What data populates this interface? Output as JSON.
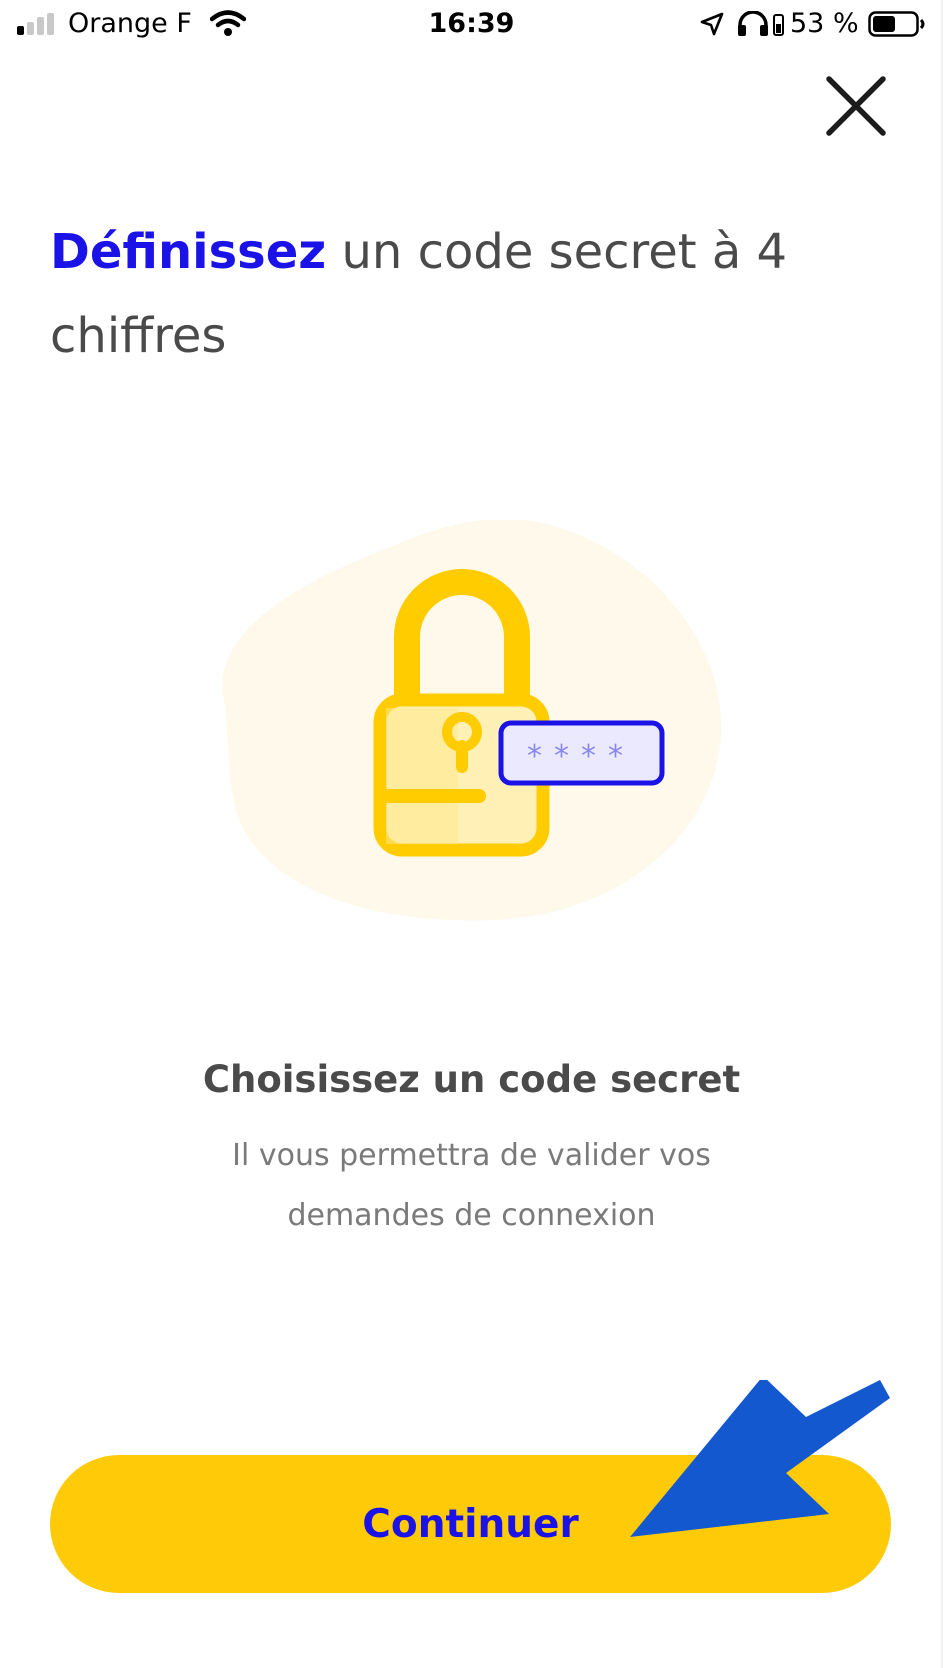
{
  "status_bar": {
    "carrier": "Orange F",
    "time": "16:39",
    "battery": "53 %",
    "signal_bars_active": 1,
    "signal_bars_total": 4,
    "icons": [
      "signal-icon",
      "wifi-icon",
      "location-arrow-icon",
      "headphones-icon",
      "battery-icon"
    ]
  },
  "header": {
    "close_icon": "close-icon"
  },
  "title": {
    "accent": "Définissez",
    "rest": " un code secret à 4 chiffres"
  },
  "illustration": {
    "icon": "padlock-icon",
    "code_mask": "****"
  },
  "info": {
    "heading": "Choisissez un code secret",
    "description": "Il vous permettra de valider vos demandes de connexion"
  },
  "continue_button": {
    "label": "Continuer"
  },
  "colors": {
    "accent_blue": "#1a12e6",
    "button_yellow": "#ffcb08",
    "lock_yellow": "#ffcc00",
    "arrow_blue": "#1458d0",
    "text_gray": "#4a4a4a"
  }
}
